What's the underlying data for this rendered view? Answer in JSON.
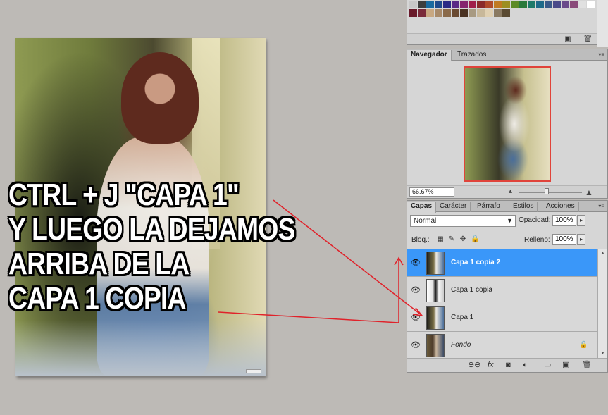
{
  "canvas": {
    "caption_lines": [
      "CTRL + J \"CAPA 1\"",
      "Y LUEGO LA DEJAMOS",
      "ARRIBA DE LA",
      "CAPA 1 COPIA"
    ]
  },
  "swatches": {
    "colors_row1": [
      "#c8c8c8",
      "#3e3e3e",
      "#1a6aa0",
      "#1f4a8c",
      "#2a2a86",
      "#5a2a86",
      "#86246e",
      "#a01e4a",
      "#8a2a2a",
      "#b04a2a",
      "#c07a22",
      "#9c8e22",
      "#5c8a26",
      "#2a7a3a",
      "#1e7a6a",
      "#1e6a8a",
      "#3a5a8a",
      "#4a4a8a",
      "#6a4a8a",
      "#8a4a7a",
      "#e0e0e0",
      "#ffffff"
    ],
    "colors_row2": [
      "#6a1a2a",
      "#7a2a3a",
      "#c8a882",
      "#a88a6a",
      "#8a6a4a",
      "#6a4a32",
      "#4a3222",
      "#a89a82",
      "#c8b89a",
      "#e0d0b2",
      "#8a7a62",
      "#5a4a32"
    ]
  },
  "navigator": {
    "tabs": [
      {
        "label": "Navegador",
        "active": true
      },
      {
        "label": "Trazados",
        "active": false
      }
    ],
    "zoom": "66.67%"
  },
  "layers": {
    "tabs": [
      {
        "label": "Capas",
        "active": true
      },
      {
        "label": "Carácter",
        "active": false
      },
      {
        "label": "Párrafo",
        "active": false
      },
      {
        "label": "Estilos",
        "active": false
      },
      {
        "label": "Acciones",
        "active": false
      }
    ],
    "blend_mode": "Normal",
    "opacity_label": "Opacidad:",
    "opacity_value": "100%",
    "lock_label": "Bloq.:",
    "fill_label": "Relleno:",
    "fill_value": "100%",
    "items": [
      {
        "name": "Capa 1 copia 2",
        "selected": true,
        "visible": true
      },
      {
        "name": "Capa 1 copia",
        "selected": false,
        "visible": true
      },
      {
        "name": "Capa 1",
        "selected": false,
        "visible": true
      },
      {
        "name": "Fondo",
        "selected": false,
        "visible": true,
        "locked": true
      }
    ]
  },
  "colors": {
    "selection": "#3a97f9",
    "annotation": "#e0222a",
    "panel_bg": "#d6d6d6"
  }
}
